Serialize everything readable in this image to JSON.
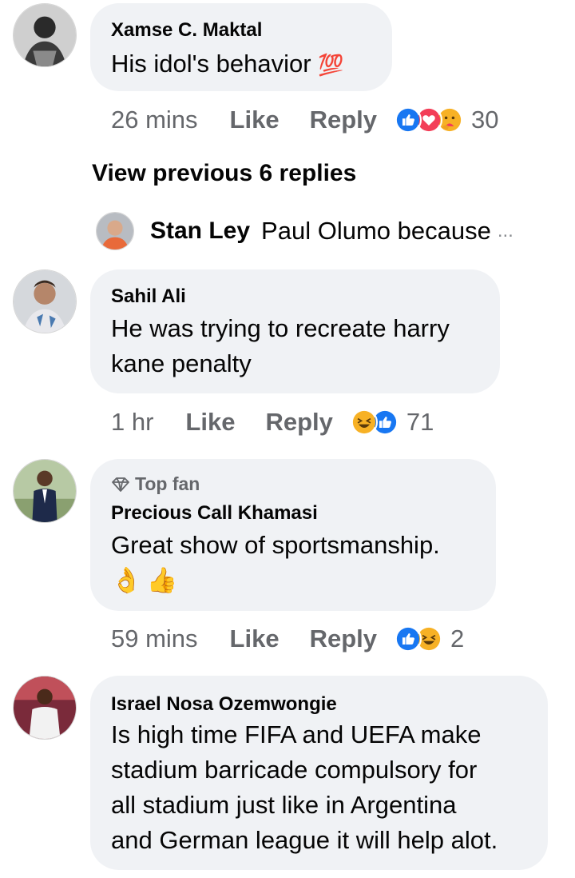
{
  "comments": [
    {
      "author": "Xamse C. Maktal",
      "text": "His idol's behavior",
      "emoji": "💯",
      "time": "26 mins",
      "like_label": "Like",
      "reply_label": "Reply",
      "reactions": [
        "like-icon",
        "love-icon",
        "care-icon"
      ],
      "reaction_count": "30"
    },
    {
      "author": "Sahil Ali",
      "text_lines": [
        "He was trying to recreate harry",
        "kane penalty"
      ],
      "time": "1 hr",
      "like_label": "Like",
      "reply_label": "Reply",
      "reactions": [
        "haha-icon",
        "like-icon"
      ],
      "reaction_count": "71"
    },
    {
      "badge": "Top fan",
      "author": "Precious Call Khamasi",
      "text": "Great show of sportsmanship.",
      "emoji_line": "👌👍",
      "time": "59 mins",
      "like_label": "Like",
      "reply_label": "Reply",
      "reactions": [
        "like-icon",
        "haha-icon"
      ],
      "reaction_count": "2"
    },
    {
      "author": "Israel Nosa Ozemwongie",
      "text_lines": [
        "Is high time FIFA and UEFA make",
        "stadium barricade compulsory for",
        "all stadium just like in Argentina",
        "and German league it will help alot."
      ]
    }
  ],
  "view_previous": "View previous 6 replies",
  "reply_preview": {
    "author": "Stan Ley",
    "text": "Paul Olumo because",
    "ellipsis": "..."
  },
  "colors": {
    "bubble": "#f0f2f5",
    "meta": "#65676b",
    "like_blue": "#1877f2",
    "love_red": "#f33e58",
    "haha_yellow": "#f7b125"
  }
}
